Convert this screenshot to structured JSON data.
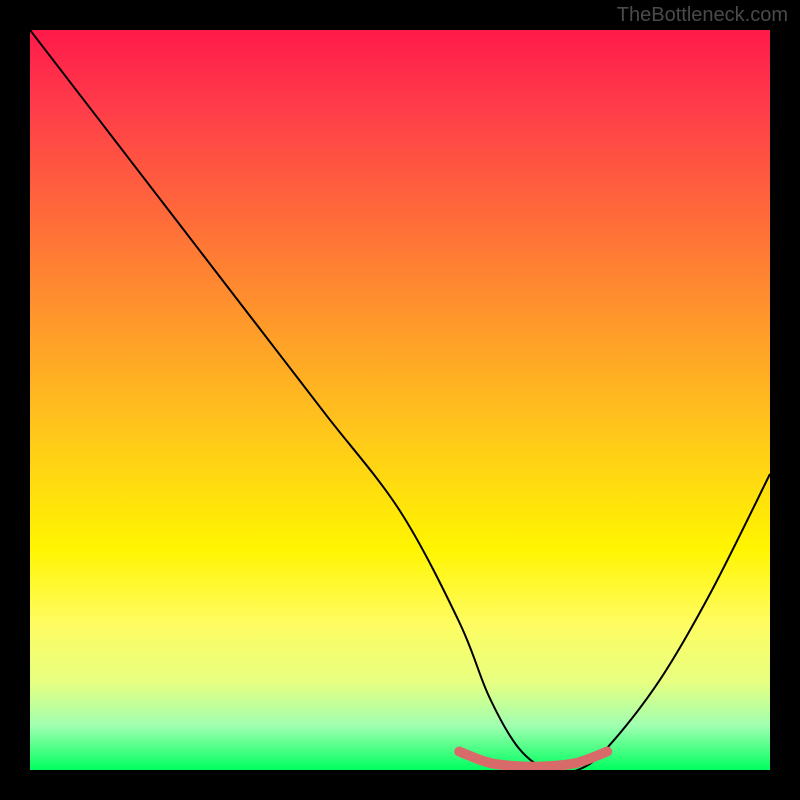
{
  "watermark": "TheBottleneck.com",
  "chart_data": {
    "type": "line",
    "title": "",
    "xlabel": "",
    "ylabel": "",
    "xlim": [
      0,
      100
    ],
    "ylim": [
      0,
      100
    ],
    "series": [
      {
        "name": "bottleneck-curve",
        "x": [
          0,
          10,
          20,
          30,
          40,
          50,
          58,
          62,
          66,
          70,
          74,
          78,
          85,
          92,
          100
        ],
        "values": [
          100,
          87,
          74,
          61,
          48,
          35,
          20,
          10,
          3,
          0,
          0,
          3,
          12,
          24,
          40
        ]
      },
      {
        "name": "optimal-band",
        "x": [
          58,
          62,
          66,
          70,
          74,
          78
        ],
        "values": [
          2.5,
          1.0,
          0.5,
          0.5,
          1.0,
          2.5
        ]
      }
    ],
    "colors": {
      "curve": "#000000",
      "optimal_band": "#d96a6a",
      "gradient_top": "#ff1a4a",
      "gradient_mid": "#fff500",
      "gradient_bottom": "#00ff60"
    }
  }
}
